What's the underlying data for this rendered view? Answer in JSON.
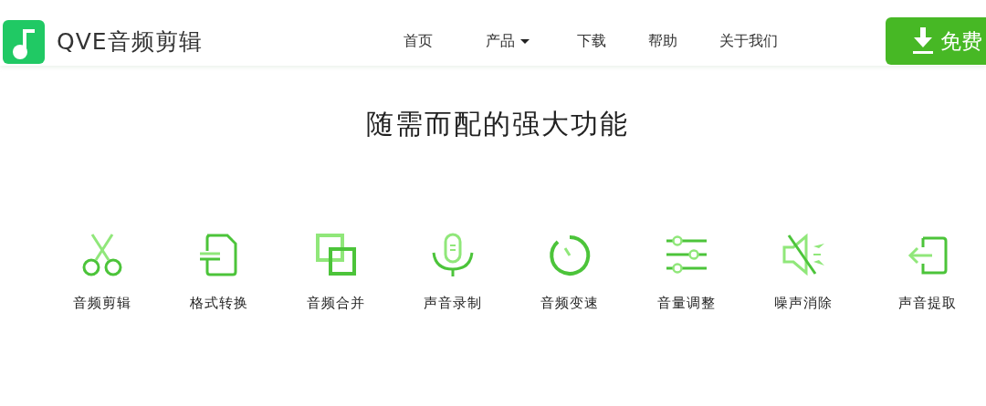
{
  "header": {
    "brand": "QVE音频剪辑",
    "nav": [
      {
        "label": "首页",
        "dropdown": false
      },
      {
        "label": "产品",
        "dropdown": true
      },
      {
        "label": "下载",
        "dropdown": false
      },
      {
        "label": "帮助",
        "dropdown": false
      },
      {
        "label": "关于我们",
        "dropdown": false
      }
    ],
    "cta": "免费"
  },
  "section": {
    "title": "随需而配的强大功能",
    "features": [
      {
        "label": "音频剪辑"
      },
      {
        "label": "格式转换"
      },
      {
        "label": "音频合并"
      },
      {
        "label": "声音录制"
      },
      {
        "label": "音频变速"
      },
      {
        "label": "音量调整"
      },
      {
        "label": "噪声消除"
      },
      {
        "label": "声音提取"
      }
    ]
  }
}
